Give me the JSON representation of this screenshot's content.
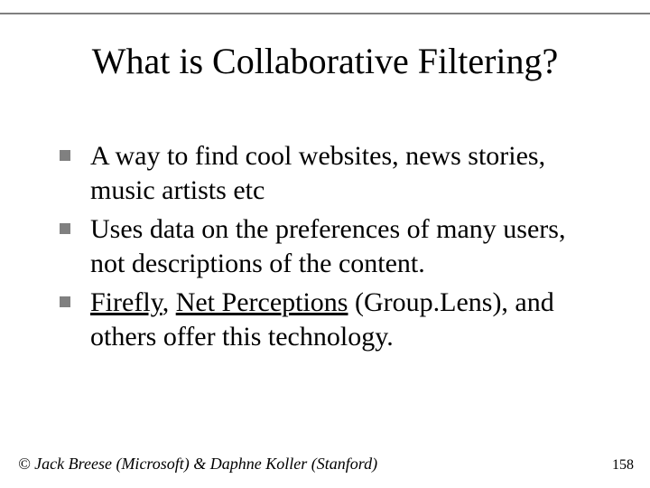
{
  "title": "What is Collaborative Filtering?",
  "bullets": [
    {
      "pre": "A way to find cool websites, news stories, music artists etc"
    },
    {
      "pre": "Uses data on the preferences of many users, not descriptions of the content."
    },
    {
      "link1": "Firefly",
      "sep": ", ",
      "link2": "Net Perceptions",
      "post": " (Group.Lens), and others offer this technology."
    }
  ],
  "footer": "© Jack Breese (Microsoft) & Daphne Koller (Stanford)",
  "page": "158"
}
